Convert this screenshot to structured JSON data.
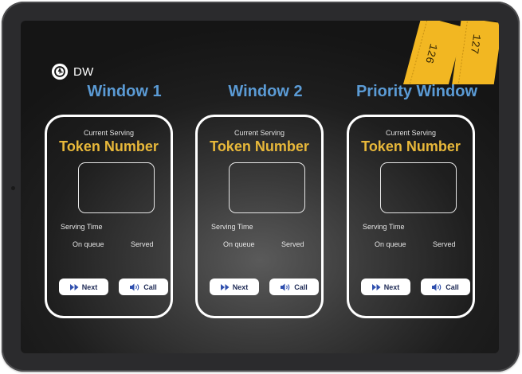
{
  "brand": {
    "name": "DW",
    "logo_icon": "aperture-icon"
  },
  "tickets": {
    "numbers": [
      "126",
      "127"
    ],
    "color": "#f2b722"
  },
  "windows": [
    {
      "title": "Window 1",
      "current_serving_label": "Current Serving",
      "token_label": "Token Number",
      "serving_time_label": "Serving Time",
      "on_queue_label": "On queue",
      "served_label": "Served",
      "next_label": "Next",
      "call_label": "Call"
    },
    {
      "title": "Window 2",
      "current_serving_label": "Current Serving",
      "token_label": "Token Number",
      "serving_time_label": "Serving Time",
      "on_queue_label": "On queue",
      "served_label": "Served",
      "next_label": "Next",
      "call_label": "Call"
    },
    {
      "title": "Priority Window",
      "current_serving_label": "Current Serving",
      "token_label": "Token Number",
      "serving_time_label": "Serving Time",
      "on_queue_label": "On queue",
      "served_label": "Served",
      "next_label": "Next",
      "call_label": "Call"
    }
  ],
  "colors": {
    "title": "#5b9bd5",
    "token_label": "#e8b83a",
    "button_text": "#1e2a55",
    "button_bg": "#ffffff"
  },
  "icons": {
    "next": "fast-forward-icon",
    "call": "speaker-icon"
  }
}
